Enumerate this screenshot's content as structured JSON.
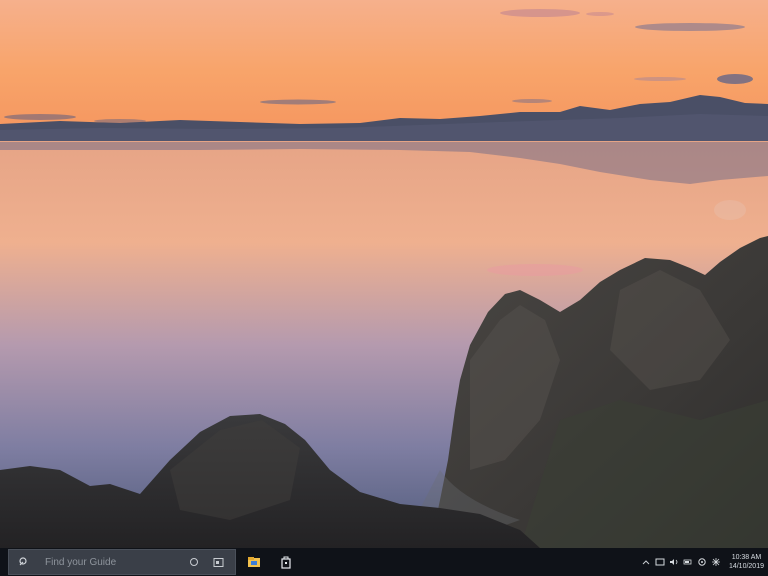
{
  "wallpaper": {
    "description_colors": {
      "sky_top": "#f7b58a",
      "sky_horizon": "#f59a62",
      "water_top": "#e9a98a",
      "water_mid": "#9e8fb0",
      "water_bottom": "#54607e",
      "mountains": "#3d4458",
      "rock": "#2b2a2c"
    }
  },
  "taskbar": {
    "search": {
      "placeholder": "Find your Guide",
      "icon": "search-icon",
      "right_icon": "mic-icon"
    },
    "pinned": [
      {
        "icon": "file-explorer-icon"
      },
      {
        "icon": "store-icon"
      }
    ],
    "tray": {
      "icons": [
        "chevron-up-icon",
        "network-icon",
        "volume-icon",
        "battery-icon",
        "notification-icon",
        "settings-icon"
      ],
      "time": "10:38 AM",
      "date": "14/10/2019"
    },
    "background": "#0f1218",
    "search_bg": "#3a3f48"
  }
}
